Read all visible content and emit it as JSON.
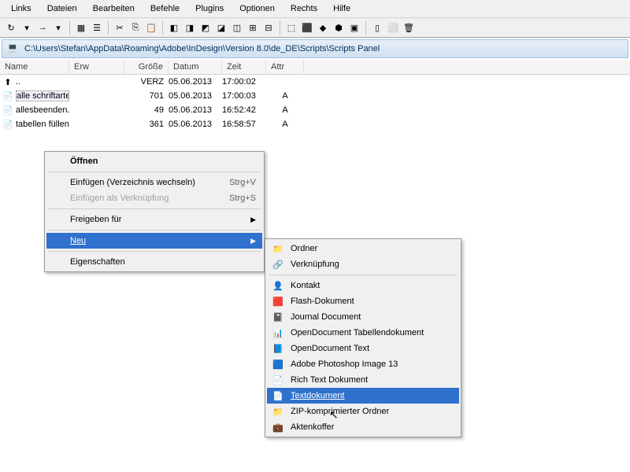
{
  "menu": [
    "Links",
    "Dateien",
    "Bearbeiten",
    "Befehle",
    "Plugins",
    "Optionen",
    "Rechts",
    "Hilfe"
  ],
  "path": "C:\\Users\\Stefan\\AppData\\Roaming\\Adobe\\InDesign\\Version 8.0\\de_DE\\Scripts\\Scripts Panel",
  "headers": {
    "name": "Name",
    "ext": "Erw",
    "size": "Größe",
    "date": "Datum",
    "time": "Zeit",
    "attr": "Attr"
  },
  "rows": [
    {
      "icon": "up",
      "name": "..",
      "ext": "",
      "size": "VERZ",
      "date": "05.06.2013",
      "time": "17:00:02",
      "attr": ""
    },
    {
      "icon": "jsx",
      "name": "alle schriftarten.jsx",
      "ext": "",
      "size": "701",
      "date": "05.06.2013",
      "time": "17:00:03",
      "attr": "A",
      "sel": true
    },
    {
      "icon": "jsx",
      "name": "allesbeenden.jsx",
      "ext": "",
      "size": "49",
      "date": "05.06.2013",
      "time": "16:52:42",
      "attr": "A"
    },
    {
      "icon": "jsx",
      "name": "tabellen füllen.jsx",
      "ext": "",
      "size": "361",
      "date": "05.06.2013",
      "time": "16:58:57",
      "attr": "A"
    }
  ],
  "ctx1": {
    "open": "Öffnen",
    "paste": "Einfügen (Verzeichnis wechseln)",
    "paste_sc": "Strg+V",
    "pastelink": "Einfügen als Verknüpfung",
    "pastelink_sc": "Strg+S",
    "share": "Freigeben für",
    "new": "Neu",
    "props": "Eigenschaften"
  },
  "ctx2": [
    {
      "ic": "folder",
      "t": "Ordner"
    },
    {
      "ic": "link",
      "t": "Verknüpfung"
    },
    {
      "sep": true
    },
    {
      "ic": "contact",
      "t": "Kontakt"
    },
    {
      "ic": "flash",
      "t": "Flash-Dokument"
    },
    {
      "ic": "journal",
      "t": "Journal Document"
    },
    {
      "ic": "ods",
      "t": "OpenDocument Tabellendokument"
    },
    {
      "ic": "odt",
      "t": "OpenDocument Text"
    },
    {
      "ic": "psd",
      "t": "Adobe Photoshop Image 13"
    },
    {
      "ic": "rtf",
      "t": "Rich Text Dokument"
    },
    {
      "ic": "txt",
      "t": "Textdokument",
      "hl": true
    },
    {
      "ic": "zip",
      "t": "ZIP-komprimierter Ordner"
    },
    {
      "ic": "brief",
      "t": "Aktenkoffer"
    }
  ]
}
